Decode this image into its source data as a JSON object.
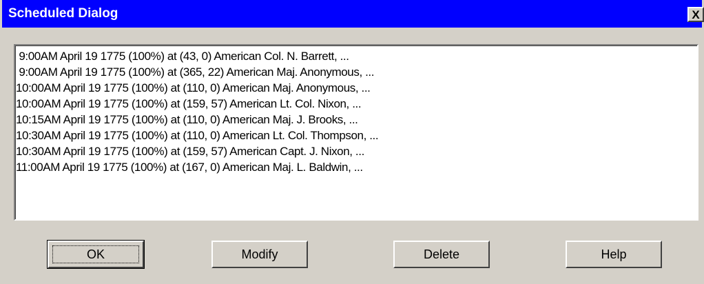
{
  "window": {
    "title": "Scheduled Dialog",
    "close_label": "X"
  },
  "schedule": {
    "items": [
      " 9:00AM April 19 1775 (100%) at (43, 0) American Col. N. Barrett, ...",
      " 9:00AM April 19 1775 (100%) at (365, 22) American Maj. Anonymous, ...",
      "10:00AM April 19 1775 (100%) at (110, 0) American Maj. Anonymous, ...",
      "10:00AM April 19 1775 (100%) at (159, 57) American Lt. Col. Nixon, ...",
      "10:15AM April 19 1775 (100%) at (110, 0) American Maj. J. Brooks, ...",
      "10:30AM April 19 1775 (100%) at (110, 0) American Lt. Col. Thompson, ...",
      "10:30AM April 19 1775 (100%) at (159, 57) American Capt. J. Nixon, ...",
      "11:00AM April 19 1775 (100%) at (167, 0) American Maj. L. Baldwin, ..."
    ]
  },
  "buttons": {
    "ok": "OK",
    "modify": "Modify",
    "delete": "Delete",
    "help": "Help"
  },
  "colors": {
    "titlebar": "#0000ff",
    "face": "#d4d0c8"
  }
}
